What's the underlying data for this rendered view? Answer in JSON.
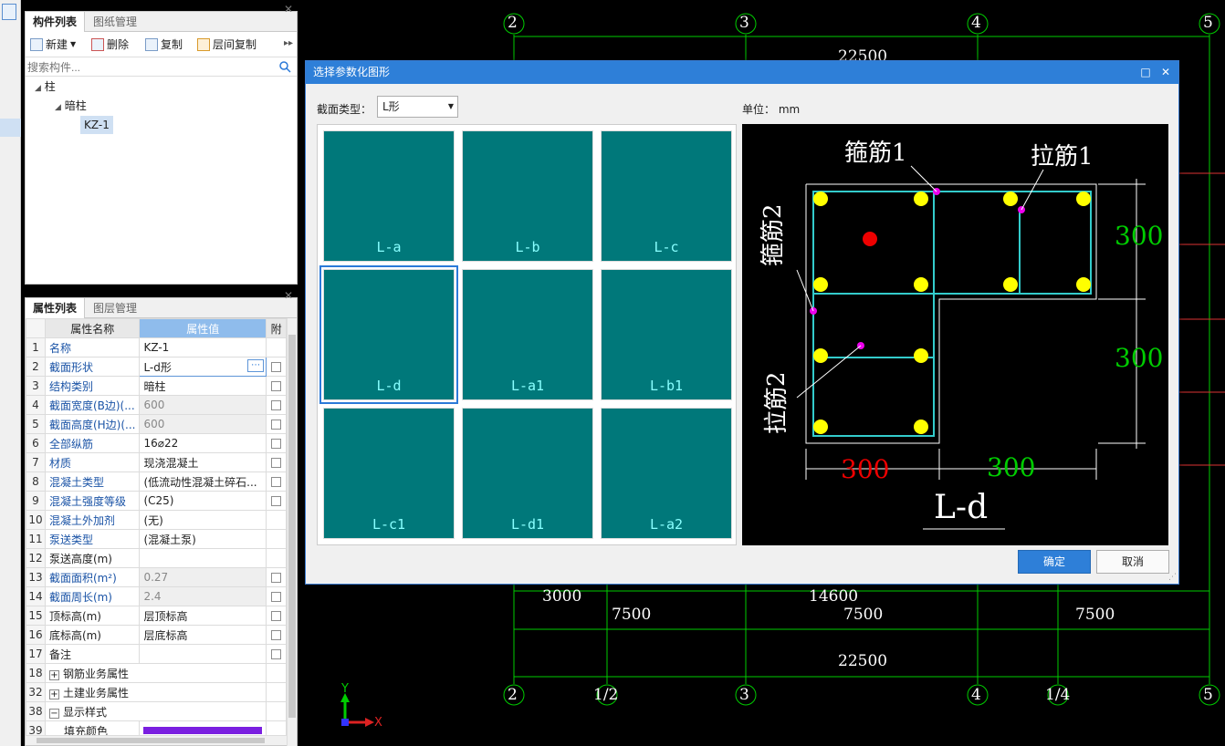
{
  "left_panel": {
    "tabs": [
      "构件列表",
      "图纸管理"
    ],
    "toolbar": {
      "new": "新建",
      "delete": "删除",
      "copy": "复制",
      "floor_copy": "层间复制"
    },
    "search_placeholder": "搜索构件...",
    "tree": {
      "root": "柱",
      "child": "暗柱",
      "leaf": "KZ-1"
    }
  },
  "props_panel": {
    "tabs": [
      "属性列表",
      "图层管理"
    ],
    "headers": {
      "name": "属性名称",
      "value": "属性值",
      "extra": "附"
    },
    "rows": [
      {
        "n": "1",
        "name": "名称",
        "value": "KZ-1",
        "blue": true,
        "grey": false,
        "chk": false
      },
      {
        "n": "2",
        "name": "截面形状",
        "value": "L-d形",
        "blue": true,
        "grey": false,
        "chk": true
      },
      {
        "n": "3",
        "name": "结构类别",
        "value": "暗柱",
        "blue": true,
        "grey": false,
        "chk": true
      },
      {
        "n": "4",
        "name": "截面宽度(B边)(...",
        "value": "600",
        "blue": true,
        "grey": true,
        "chk": true
      },
      {
        "n": "5",
        "name": "截面高度(H边)(...",
        "value": "600",
        "blue": true,
        "grey": true,
        "chk": true
      },
      {
        "n": "6",
        "name": "全部纵筋",
        "value": "16⌀22",
        "blue": true,
        "grey": false,
        "chk": true
      },
      {
        "n": "7",
        "name": "材质",
        "value": "现浇混凝土",
        "blue": true,
        "grey": false,
        "chk": true
      },
      {
        "n": "8",
        "name": "混凝土类型",
        "value": "(低流动性混凝土碎石...",
        "blue": true,
        "grey": false,
        "chk": true
      },
      {
        "n": "9",
        "name": "混凝土强度等级",
        "value": "(C25)",
        "blue": true,
        "grey": false,
        "chk": true
      },
      {
        "n": "10",
        "name": "混凝土外加剂",
        "value": "(无)",
        "blue": true,
        "grey": false,
        "chk": false
      },
      {
        "n": "11",
        "name": "泵送类型",
        "value": "(混凝土泵)",
        "blue": true,
        "grey": false,
        "chk": false
      },
      {
        "n": "12",
        "name": "泵送高度(m)",
        "value": "",
        "blue": false,
        "grey": false,
        "chk": false
      },
      {
        "n": "13",
        "name": "截面面积(m²)",
        "value": "0.27",
        "blue": true,
        "grey": true,
        "chk": true
      },
      {
        "n": "14",
        "name": "截面周长(m)",
        "value": "2.4",
        "blue": true,
        "grey": true,
        "chk": true
      },
      {
        "n": "15",
        "name": "顶标高(m)",
        "value": "层顶标高",
        "blue": false,
        "grey": false,
        "chk": true
      },
      {
        "n": "16",
        "name": "底标高(m)",
        "value": "层底标高",
        "blue": false,
        "grey": false,
        "chk": true
      },
      {
        "n": "17",
        "name": "备注",
        "value": "",
        "blue": false,
        "grey": false,
        "chk": true
      }
    ],
    "groups": [
      {
        "n": "18",
        "label": "钢筋业务属性",
        "sign": "+"
      },
      {
        "n": "32",
        "label": "土建业务属性",
        "sign": "+"
      },
      {
        "n": "38",
        "label": "显示样式",
        "sign": "−"
      }
    ],
    "partial_row": {
      "n": "39",
      "label": "填充颜色"
    }
  },
  "dialog": {
    "title": "选择参数化图形",
    "section_label": "截面类型：",
    "section_value": "L形",
    "unit_label": "单位：",
    "unit_value": "mm",
    "thumbnails": [
      "L-a",
      "L-b",
      "L-c",
      "L-d",
      "L-a1",
      "L-b1",
      "L-c1",
      "L-d1",
      "L-a2"
    ],
    "selected": "L-d",
    "preview": {
      "name": "L-d",
      "labels": {
        "stirrup1": "箍筋1",
        "tie1": "拉筋1",
        "stirrup2": "箍筋2",
        "tie2": "拉筋2"
      },
      "dims": {
        "right_top": "300",
        "right_bottom": "300",
        "bottom_left": "300",
        "bottom_right": "300"
      }
    },
    "ok": "确定",
    "cancel": "取消"
  },
  "cad": {
    "top_axes": [
      "2",
      "3",
      "4",
      "5"
    ],
    "bottom_axes": [
      "2",
      "1/2",
      "3",
      "4",
      "1/4",
      "5"
    ],
    "top_dim": "22500",
    "row1_dims": [
      "3000",
      "14600"
    ],
    "row2_dims": [
      "7500",
      "7500",
      "7500"
    ],
    "bottom_dim": "22500",
    "ucs_y": "Y",
    "ucs_x": "X"
  }
}
